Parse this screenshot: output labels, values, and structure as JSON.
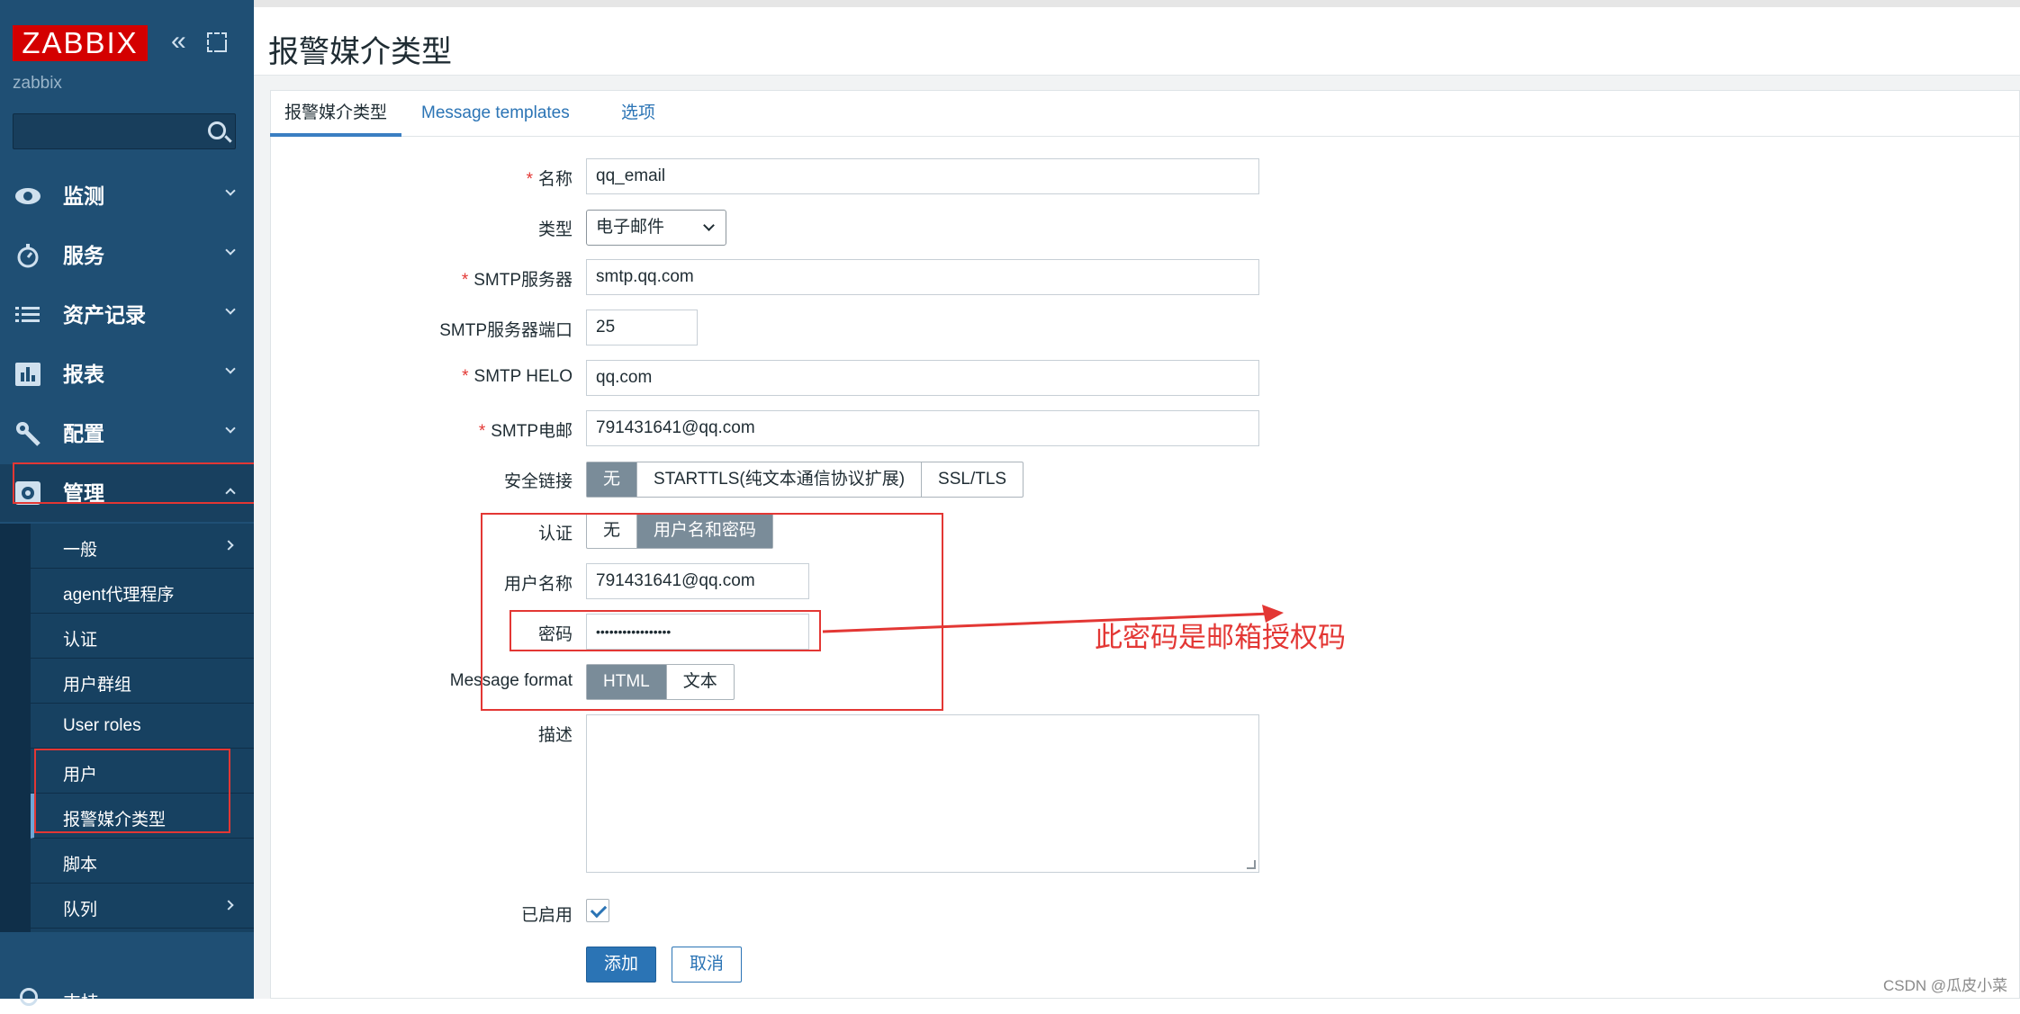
{
  "sidebar": {
    "logo": "ZABBIX",
    "server_name": "zabbix",
    "search": {
      "value": "",
      "placeholder": ""
    },
    "menu": [
      {
        "label": "监测",
        "icon": "eye-icon"
      },
      {
        "label": "服务",
        "icon": "stopwatch-icon"
      },
      {
        "label": "资产记录",
        "icon": "list-icon"
      },
      {
        "label": "报表",
        "icon": "bar-chart-icon"
      },
      {
        "label": "配置",
        "icon": "wrench-icon"
      },
      {
        "label": "管理",
        "icon": "gear-icon"
      }
    ],
    "submenu": [
      {
        "label": "一般",
        "has_arrow": true
      },
      {
        "label": "agent代理程序"
      },
      {
        "label": "认证"
      },
      {
        "label": "用户群组"
      },
      {
        "label": "User roles"
      },
      {
        "label": "用户"
      },
      {
        "label": "报警媒介类型",
        "active": true
      },
      {
        "label": "脚本"
      },
      {
        "label": "队列",
        "has_arrow": true
      }
    ],
    "bottom_label": "支持"
  },
  "page": {
    "title": "报警媒介类型",
    "tabs": [
      "报警媒介类型",
      "Message templates",
      "选项"
    ]
  },
  "form": {
    "name": {
      "label": "名称",
      "required": true,
      "value": "qq_email"
    },
    "type": {
      "label": "类型",
      "value": "电子邮件"
    },
    "smtp_server": {
      "label": "SMTP服务器",
      "required": true,
      "value": "smtp.qq.com"
    },
    "smtp_port": {
      "label": "SMTP服务器端口",
      "value": "25"
    },
    "smtp_helo": {
      "label": "SMTP HELO",
      "required": true,
      "value": "qq.com"
    },
    "smtp_email": {
      "label": "SMTP电邮",
      "required": true,
      "value": "791431641@qq.com"
    },
    "security": {
      "label": "安全链接",
      "options": [
        "无",
        "STARTTLS(纯文本通信协议扩展)",
        "SSL/TLS"
      ],
      "selected": "无"
    },
    "auth": {
      "label": "认证",
      "options": [
        "无",
        "用户名和密码"
      ],
      "selected": "用户名和密码"
    },
    "username": {
      "label": "用户名称",
      "value": "791431641@qq.com"
    },
    "password": {
      "label": "密码",
      "value": "•••••••••••••••••"
    },
    "message_format": {
      "label": "Message format",
      "options": [
        "HTML",
        "文本"
      ],
      "selected": "HTML"
    },
    "description": {
      "label": "描述",
      "value": ""
    },
    "enabled": {
      "label": "已启用",
      "checked": true
    },
    "add_button": "添加",
    "cancel_button": "取消"
  },
  "annotation": {
    "text": "此密码是邮箱授权码",
    "color": "#e33734"
  },
  "watermark": "CSDN @瓜皮小菜"
}
